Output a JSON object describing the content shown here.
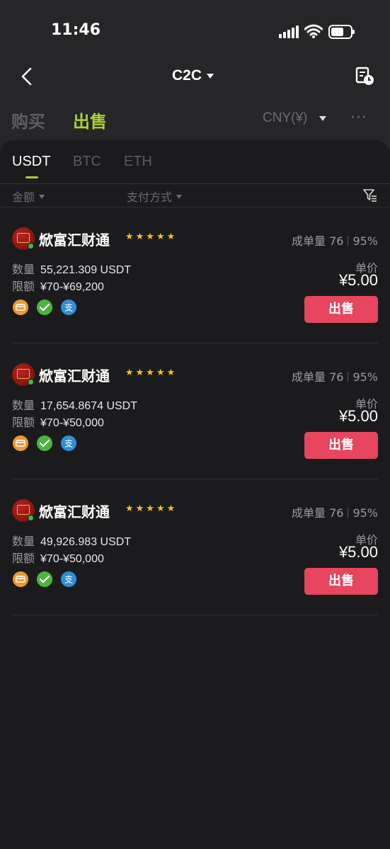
{
  "status_bar": {
    "time": "11:46"
  },
  "nav": {
    "title": "C2C"
  },
  "mode_tabs": [
    {
      "label": "购买"
    },
    {
      "label": "出售"
    }
  ],
  "currency": "CNY(¥)",
  "more": "···",
  "coin_tabs": [
    {
      "label": "USDT"
    },
    {
      "label": "BTC"
    },
    {
      "label": "ETH"
    }
  ],
  "filters": {
    "amount": "金额",
    "payment": "支付方式"
  },
  "labels": {
    "qty": "数量",
    "limit": "限额",
    "unit_price": "单价",
    "orders": "成单量",
    "sell": "出售"
  },
  "listings": [
    {
      "merchant": "焮富汇财通",
      "stars": "★★★★★",
      "orders": "76",
      "rate": "95%",
      "quantity": "55,221.309 USDT",
      "limit": "¥70-¥69,200",
      "price": "¥5.00"
    },
    {
      "merchant": "焮富汇财通",
      "stars": "★★★★★",
      "orders": "76",
      "rate": "95%",
      "quantity": "17,654.8674 USDT",
      "limit": "¥70-¥50,000",
      "price": "¥5.00"
    },
    {
      "merchant": "焮富汇财通",
      "stars": "★★★★★",
      "orders": "76",
      "rate": "95%",
      "quantity": "49,926.983 USDT",
      "limit": "¥70-¥50,000",
      "price": "¥5.00"
    }
  ],
  "colors": {
    "accent_green": "#a8d037",
    "sell_red": "#e8455e",
    "star_yellow": "#f6c21a",
    "background": "#1b1b1d"
  },
  "icons": [
    "back-chevron-icon",
    "order-history-icon",
    "filter-icon",
    "bank-card-icon",
    "wechat-pay-icon",
    "alipay-icon"
  ]
}
